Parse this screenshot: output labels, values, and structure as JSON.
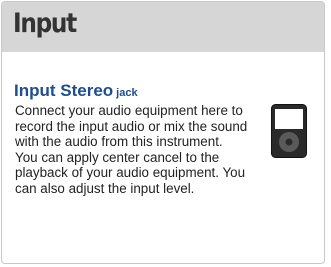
{
  "header": {
    "title": "Input"
  },
  "section": {
    "title": "Input Stereo",
    "title_suffix": "jack",
    "paragraphs": [
      "Connect your audio equipment here to record the input audio or mix the sound with the audio from this instrument.",
      "You can apply center cancel to the playback of your audio equipment. You can also adjust the input level."
    ]
  },
  "icons": {
    "device": "audio-player-icon"
  },
  "colors": {
    "header_bg": "#d6d6d6",
    "title_blue": "#1d4e8f",
    "border": "#c9c9c9"
  }
}
